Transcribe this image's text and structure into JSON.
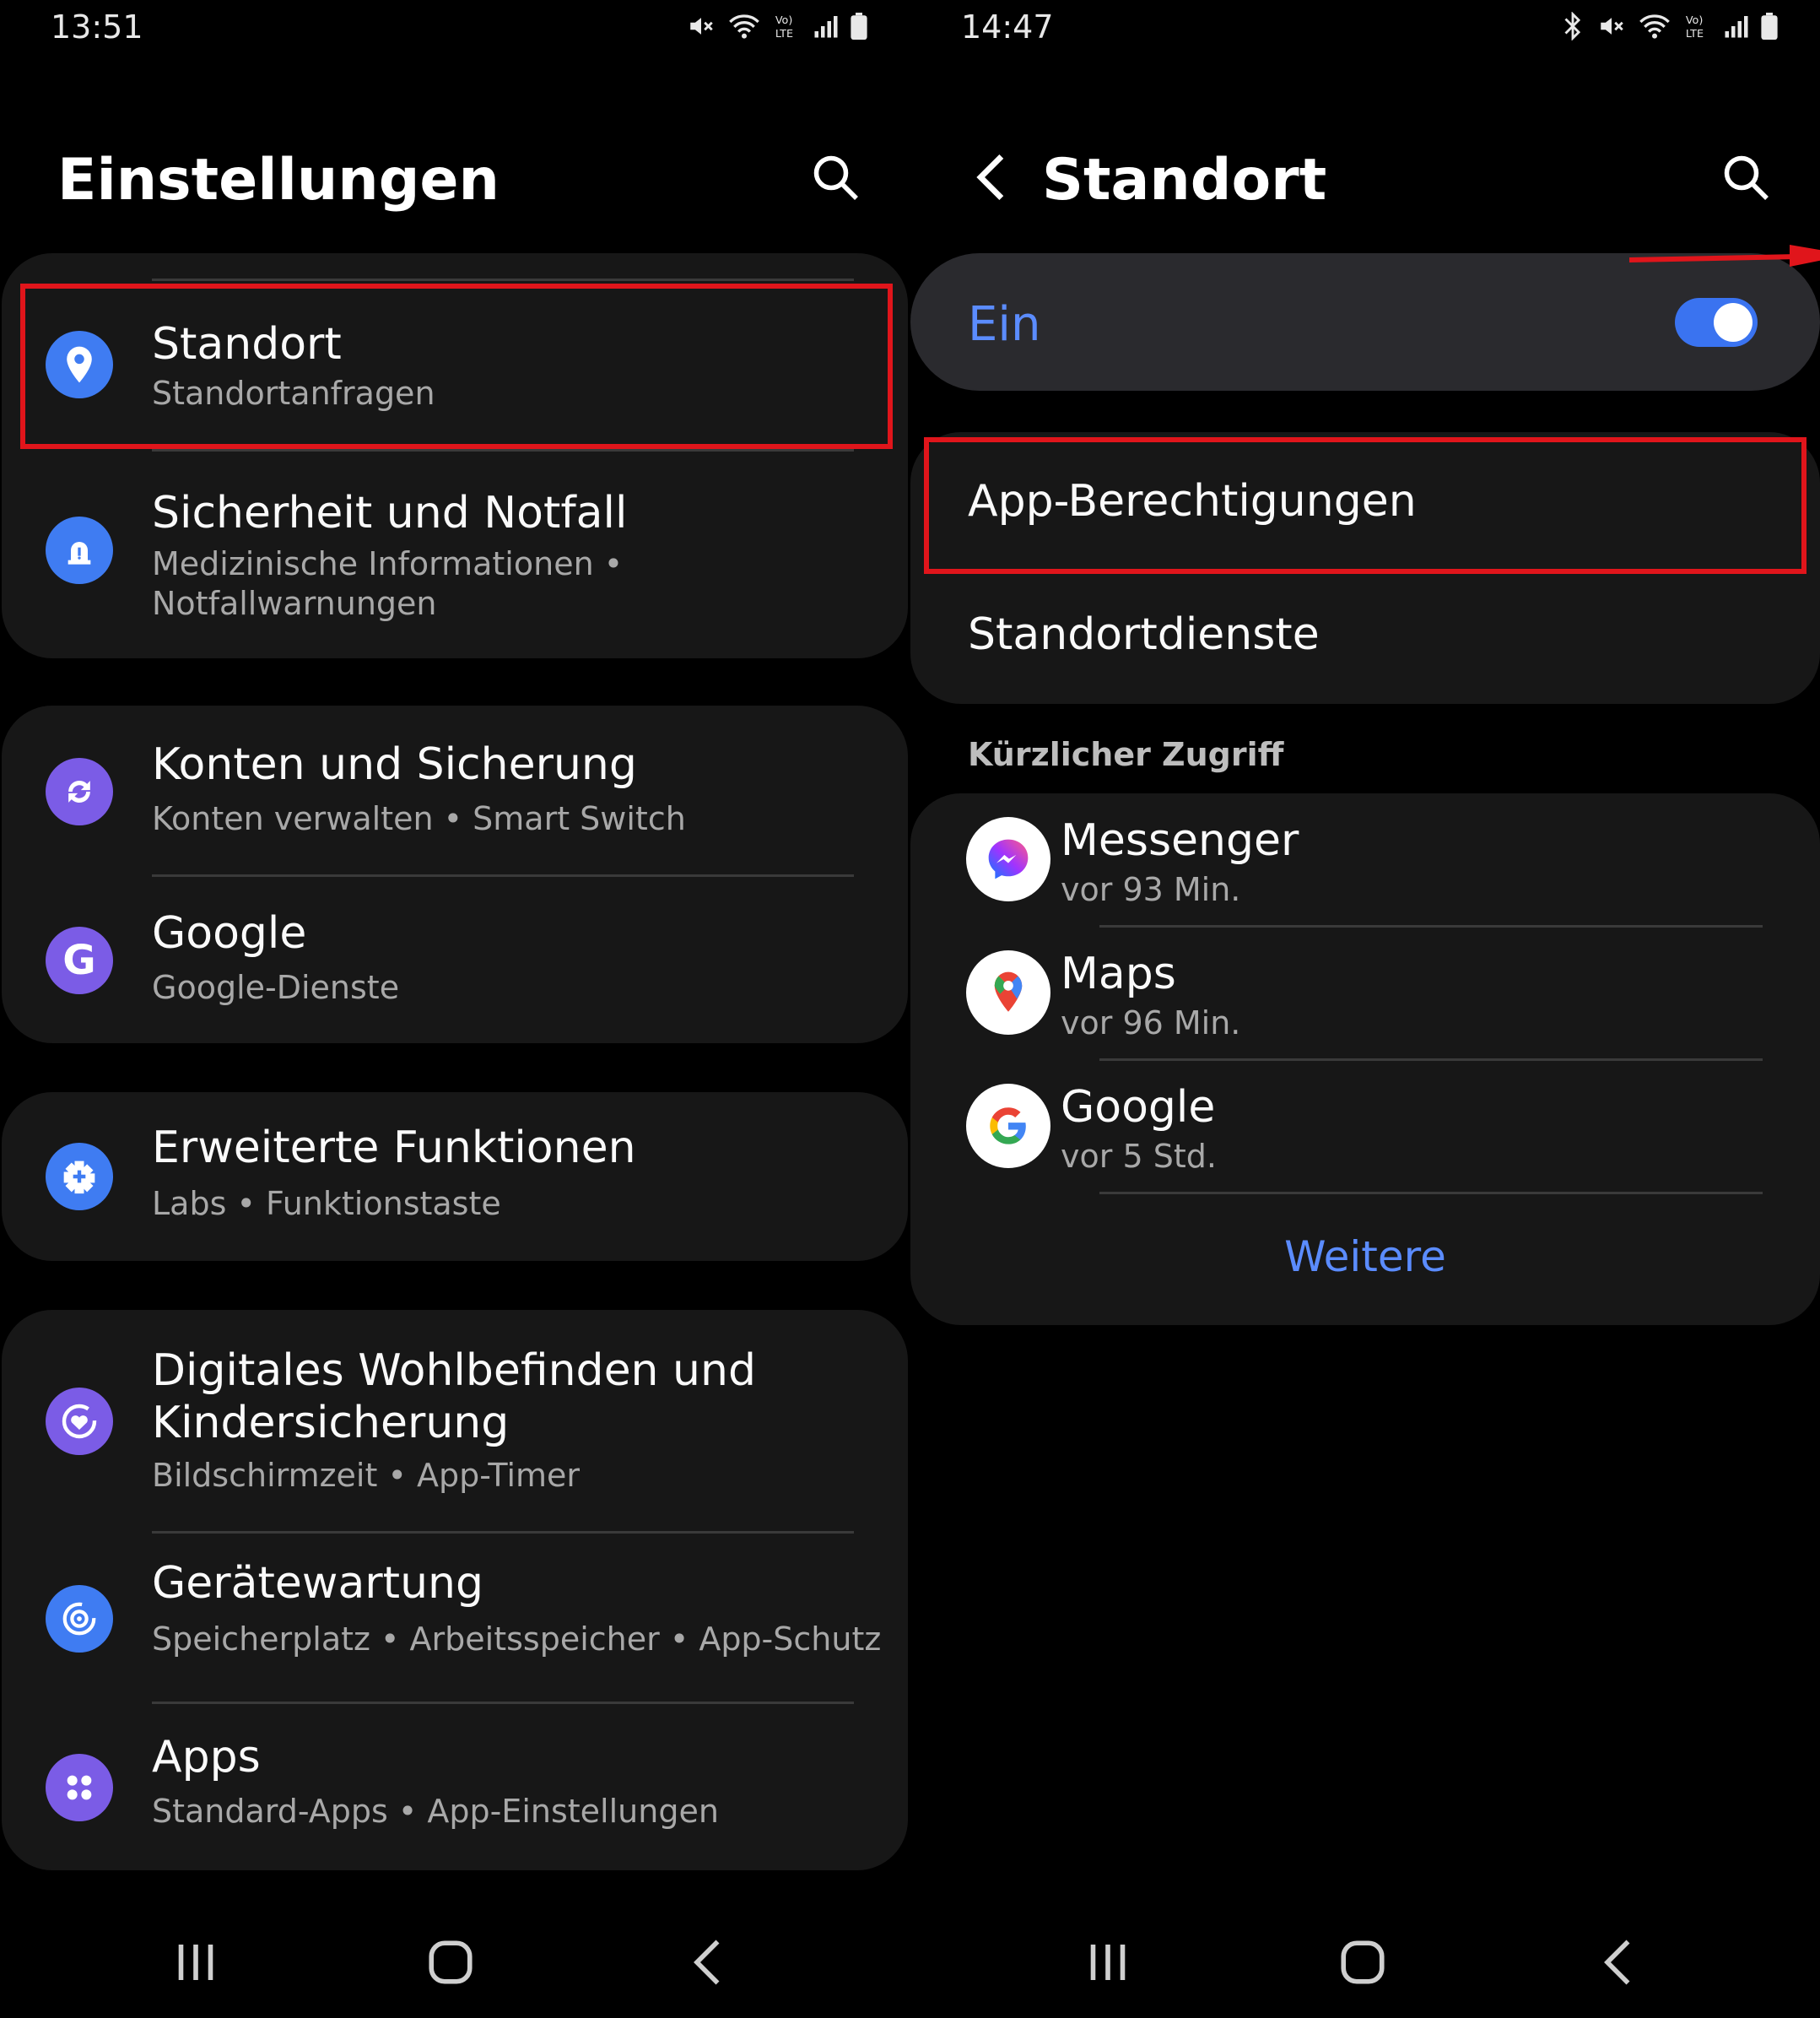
{
  "left": {
    "status_time": "13:51",
    "title": "Einstellungen",
    "items": [
      {
        "title": "Standort",
        "subtitle": "Standortanfragen"
      },
      {
        "title": "Sicherheit und Notfall",
        "subtitle_line1": "Medizinische Informationen  •",
        "subtitle_line2": "Notfallwarnungen"
      },
      {
        "title": "Konten und Sicherung",
        "subtitle": "Konten verwalten  •  Smart Switch"
      },
      {
        "title": "Google",
        "subtitle": "Google-Dienste"
      },
      {
        "title": "Erweiterte Funktionen",
        "subtitle": "Labs  •  Funktionstaste"
      },
      {
        "title_line1": "Digitales Wohlbefinden und",
        "title_line2": "Kindersicherung",
        "subtitle": "Bildschirmzeit  •  App-Timer"
      },
      {
        "title": "Gerätewartung",
        "subtitle": "Speicherplatz  •  Arbeitsspeicher  •  App-Schutz"
      },
      {
        "title": "Apps",
        "subtitle": "Standard-Apps  •  App-Einstellungen"
      }
    ]
  },
  "right": {
    "status_time": "14:47",
    "title": "Standort",
    "toggle_label": "Ein",
    "toggle_on": true,
    "menu": [
      "App-Berechtigungen",
      "Standortdienste"
    ],
    "recent_label": "Kürzlicher Zugriff",
    "recent": [
      {
        "name": "Messenger",
        "time": "vor 93 Min.",
        "icon": "messenger-icon"
      },
      {
        "name": "Maps",
        "time": "vor 96 Min.",
        "icon": "maps-icon"
      },
      {
        "name": "Google",
        "time": "vor 5 Std.",
        "icon": "google-icon"
      }
    ],
    "more": "Weitere"
  },
  "colors": {
    "accent": "#5b8cff",
    "highlight": "#e0151b",
    "card": "#171717",
    "toggle_card": "#2a2a2e"
  }
}
